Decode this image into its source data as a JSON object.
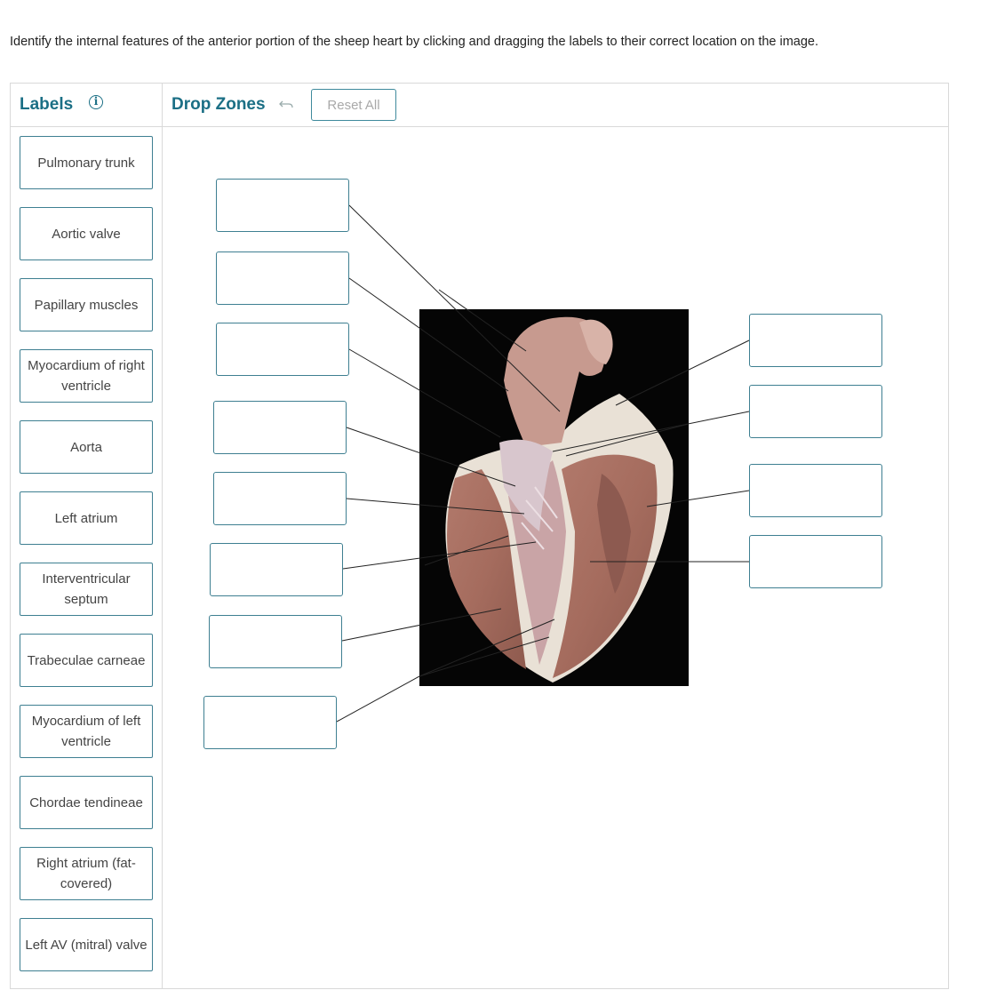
{
  "prompt": "Identify the internal features of the anterior portion of the sheep heart by clicking and dragging the labels to their correct location on the image.",
  "labels_panel": {
    "title": "Labels"
  },
  "dropzones_panel": {
    "title": "Drop Zones",
    "reset_label": "Reset All"
  },
  "labels": [
    "Pulmonary trunk",
    "Aortic valve",
    "Papillary muscles",
    "Myocardium of right ventricle",
    "Aorta",
    "Left atrium",
    "Interventricular septum",
    "Trabeculae carneae",
    "Myocardium of left ventricle",
    "Chordae tendineae",
    "Right atrium (fat-covered)",
    "Left AV (mitral) valve"
  ],
  "colors": {
    "accent": "#1b6f85",
    "border": "#3e7f91",
    "image_bg": "#050505"
  },
  "icons": {
    "info": "info-circle-icon",
    "undo": "undo-arrow-icon"
  }
}
